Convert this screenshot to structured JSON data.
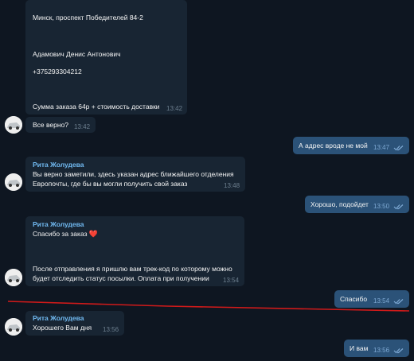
{
  "incoming_top": {
    "address": "Минск,  проспект Победителей 84-2",
    "name_line": "Адамович Денис Антонович",
    "phone": "+375293304212",
    "total": "Сумма заказа 64р + стоимость доставки",
    "time": "13:42"
  },
  "incoming_check": {
    "text": "Все верно?",
    "time": "13:42"
  },
  "out_1": {
    "text": "А адрес вроде не мой",
    "time": "13:47"
  },
  "incoming_2": {
    "sender": "Рита Жолудева",
    "line1": "Вы верно заметили, здесь указан адрес ближайшего отделения",
    "line2": "Европочты, где бы вы могли получить свой заказ",
    "time": "13:48"
  },
  "out_2": {
    "text": "Хорошо, подойдет",
    "time": "13:50"
  },
  "incoming_3": {
    "sender": "Рита Жолудева",
    "line1": "Спасибо за заказ",
    "heart": "❤️",
    "line2": "После отправления я пришлю вам трек-код по которому можно",
    "line3": "будет отследить статус посылки. Оплата при получении",
    "time": "13:54"
  },
  "out_3": {
    "text": "Спасибо",
    "time": "13:54"
  },
  "incoming_4": {
    "sender": "Рита Жолудева",
    "text": "Хорошего Вам дня",
    "time": "13:56"
  },
  "out_4": {
    "text": "И вам",
    "time": "13:56"
  },
  "colors": {
    "background": "#0e1621",
    "incoming_bubble": "#182533",
    "outgoing_bubble": "#2b5278",
    "sender_name": "#71baf2",
    "annotation_line": "#d11a1a"
  },
  "icons": {
    "read": "double-check-icon",
    "avatar": "car-avatar"
  }
}
